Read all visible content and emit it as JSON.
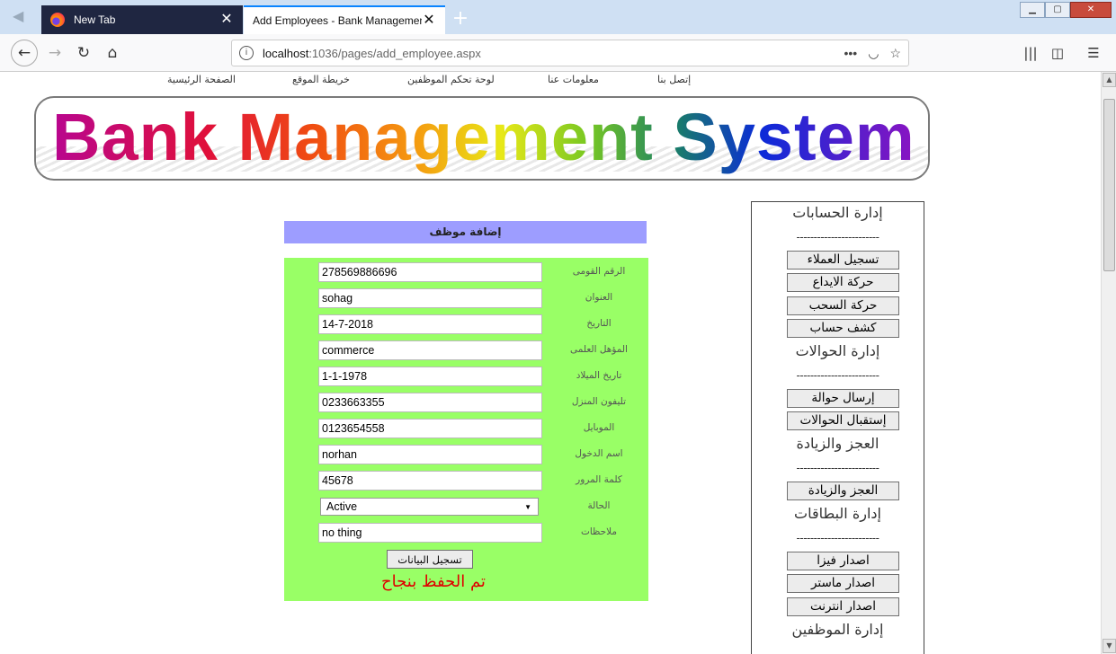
{
  "browser": {
    "tabs": [
      {
        "title": "New Tab"
      },
      {
        "title": "Add Employees - Bank Management Syste"
      }
    ],
    "url_host": "localhost",
    "url_path": ":1036/pages/add_employee.aspx",
    "icons": [
      "back-icon",
      "forward-icon",
      "reload-icon",
      "home-icon",
      "info-icon",
      "page-actions-icon",
      "pocket-icon",
      "bookmark-star-icon",
      "library-icon",
      "sidebar-icon",
      "menu-icon"
    ]
  },
  "topmenu": {
    "home": "الصفحة الرئيسية",
    "sitemap": "خريطة الموقع",
    "dashboard": "لوحة تحكم الموظفين",
    "about": "معلومات عنا",
    "contact": "إتصل بنا"
  },
  "banner": {
    "logo_text": "Bank Management System"
  },
  "form": {
    "heading": "إضافة موظف",
    "fields": [
      {
        "label": "الرقم القومى",
        "value": "278569886696"
      },
      {
        "label": "العنوان",
        "value": "sohag"
      },
      {
        "label": "التاريخ",
        "value": "14-7-2018"
      },
      {
        "label": "المؤهل العلمى",
        "value": "commerce"
      },
      {
        "label": "تاريخ الميلاد",
        "value": "1-1-1978"
      },
      {
        "label": "تليفون المنزل",
        "value": "0233663355"
      },
      {
        "label": "الموبايل",
        "value": "0123654558"
      },
      {
        "label": "اسم الدخول",
        "value": "norhan"
      },
      {
        "label": "كلمة المرور",
        "value": "45678"
      },
      {
        "label": "الحالة",
        "value": "Active"
      },
      {
        "label": "ملاحظات",
        "value": "no thing"
      }
    ],
    "submit_label": "تسجيل البيانات",
    "success_message": "تم الحفظ بنجاح"
  },
  "sidebar": {
    "separator": "------------------------",
    "accounts_title": "إدارة الحسابات",
    "register_clients": "تسجيل العملاء",
    "deposit": "حركة الايداع",
    "withdraw": "حركة السحب",
    "statement": "كشف حساب",
    "transfers_title": "إدارة الحوالات",
    "send_transfer": "إرسال حوالة",
    "receive_transfers": "إستقبال الحوالات",
    "deficit_title": "العجز والزيادة",
    "deficit_button": "العجز والزيادة",
    "cards_title": "إدارة البطاقات",
    "issue_visa": "اصدار فيزا",
    "issue_master": "اصدار ماستر",
    "issue_internet": "اصدار انترنت",
    "employees_title": "إدارة الموظفين"
  },
  "colors": {
    "form_header_bg": "#9d9dff",
    "form_bg": "#99ff66",
    "success_text": "#e00000",
    "tab_dark": "#1f2641"
  }
}
